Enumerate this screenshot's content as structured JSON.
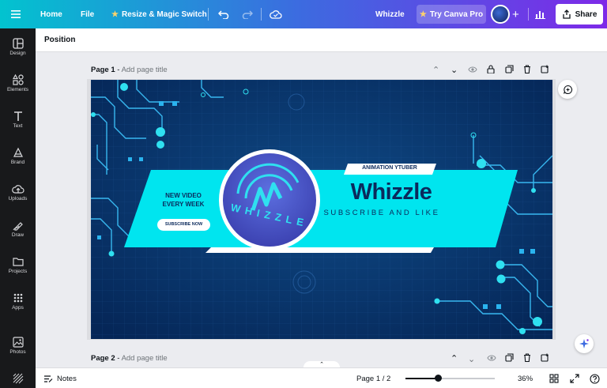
{
  "topbar": {
    "home": "Home",
    "file": "File",
    "resize": "Resize & Magic Switch",
    "doc_title": "Whizzle",
    "try_pro": "Try Canva Pro",
    "share": "Share"
  },
  "sidebar": {
    "items": [
      {
        "label": "Design",
        "icon": "layout-icon"
      },
      {
        "label": "Elements",
        "icon": "shapes-icon"
      },
      {
        "label": "Text",
        "icon": "text-icon"
      },
      {
        "label": "Brand",
        "icon": "brand-icon"
      },
      {
        "label": "Uploads",
        "icon": "cloud-upload-icon"
      },
      {
        "label": "Draw",
        "icon": "pen-icon"
      },
      {
        "label": "Projects",
        "icon": "folder-icon"
      },
      {
        "label": "Apps",
        "icon": "grid-icon"
      },
      {
        "label": "Photos",
        "icon": "image-icon"
      }
    ]
  },
  "toolbar": {
    "position": "Position"
  },
  "pages": [
    {
      "name": "Page 1",
      "add_title": "Add page title"
    },
    {
      "name": "Page 2",
      "add_title": "Add page title"
    }
  ],
  "banner": {
    "new_video": "NEW VIDEO",
    "every_week": "EVERY WEEK",
    "subscribe_now": "SUBSCRIBE NOW",
    "tag": "ANIMATION YTUBER",
    "title": "Whizzle",
    "subtitle": "SUBSCRIBE AND LIKE",
    "logo_text": "WHIZZLE"
  },
  "bottombar": {
    "notes": "Notes",
    "page_indicator": "Page 1 / 2",
    "zoom": "36%",
    "zoom_level": 0.36
  },
  "colors": {
    "gradient_start": "#02c3cf",
    "gradient_end": "#7d2ae8",
    "banner_cyan": "#00e5ef",
    "banner_dark": "#072f66"
  }
}
